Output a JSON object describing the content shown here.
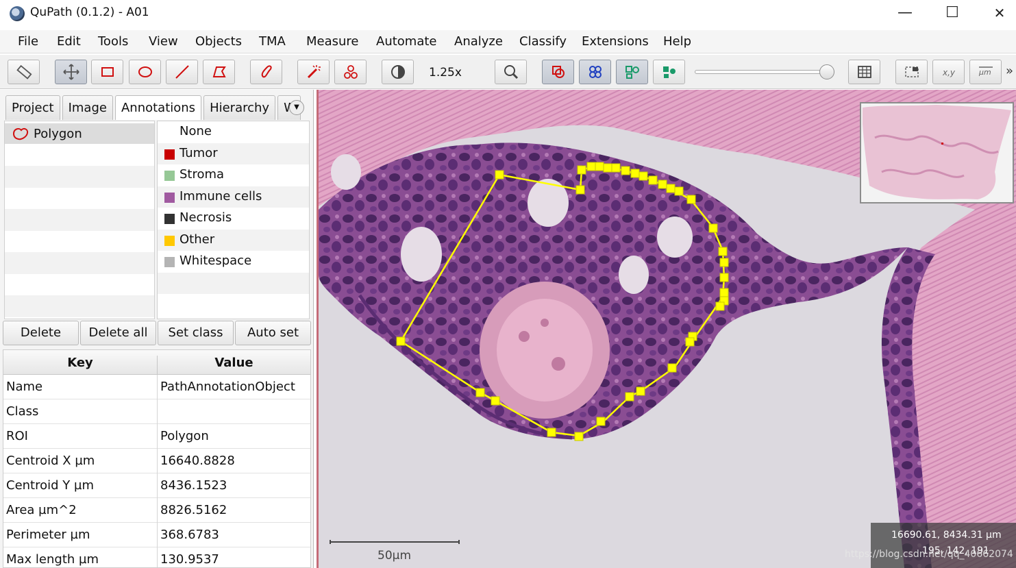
{
  "window": {
    "title": "QuPath (0.1.2) - A01",
    "minimize": "—",
    "maximize": "☐",
    "close": "✕"
  },
  "menu": [
    "File",
    "Edit",
    "Tools",
    "View",
    "Objects",
    "TMA",
    "Measure",
    "Automate",
    "Analyze",
    "Classify",
    "Extensions",
    "Help"
  ],
  "toolbar": {
    "zoom": "1.25x",
    "tools": [
      "ruler-icon",
      "move-icon",
      "rectangle-icon",
      "ellipse-icon",
      "line-icon",
      "polygon-icon",
      "brush-icon",
      "wand-icon",
      "points-icon",
      "contrast-icon",
      "zoom-to-fit-icon",
      "show-annotations-icon",
      "show-tma-grid-icon",
      "show-detections-icon",
      "fill-detections-icon",
      "measurement-table-icon",
      "overview-icon",
      "cursor-location-icon",
      "scalebar-icon"
    ]
  },
  "tabs": [
    "Project",
    "Image",
    "Annotations",
    "Hierarchy",
    "W"
  ],
  "active_tab": "Annotations",
  "annotations": [
    {
      "label": "Polygon"
    }
  ],
  "classes": [
    {
      "name": "None",
      "color": ""
    },
    {
      "name": "Tumor",
      "color": "#c80000"
    },
    {
      "name": "Stroma",
      "color": "#96c896"
    },
    {
      "name": "Immune cells",
      "color": "#a05aa0"
    },
    {
      "name": "Necrosis",
      "color": "#323232"
    },
    {
      "name": "Other",
      "color": "#ffc800"
    },
    {
      "name": "Whitespace",
      "color": "#b4b4b4"
    }
  ],
  "buttons": [
    "Delete",
    "Delete all",
    "Set class",
    "Auto set"
  ],
  "properties": {
    "header": {
      "key": "Key",
      "value": "Value"
    },
    "rows": [
      {
        "key": "Name",
        "value": "PathAnnotationObject"
      },
      {
        "key": "Class",
        "value": ""
      },
      {
        "key": "ROI",
        "value": "Polygon"
      },
      {
        "key": "Centroid X µm",
        "value": "16640.8828"
      },
      {
        "key": "Centroid Y µm",
        "value": "8436.1523"
      },
      {
        "key": "Area µm^2",
        "value": "8826.5162"
      },
      {
        "key": "Perimeter µm",
        "value": "368.6783"
      },
      {
        "key": "Max length µm",
        "value": "130.9537"
      }
    ]
  },
  "viewer": {
    "scalebar_label": "50µm",
    "cursor_coords": "16690.61, 8434.31 µm",
    "cursor_rgb": "195, 142, 191",
    "watermark": "https://blog.csdn.net/qq_40662074",
    "annotation_color": "#ffff00"
  }
}
